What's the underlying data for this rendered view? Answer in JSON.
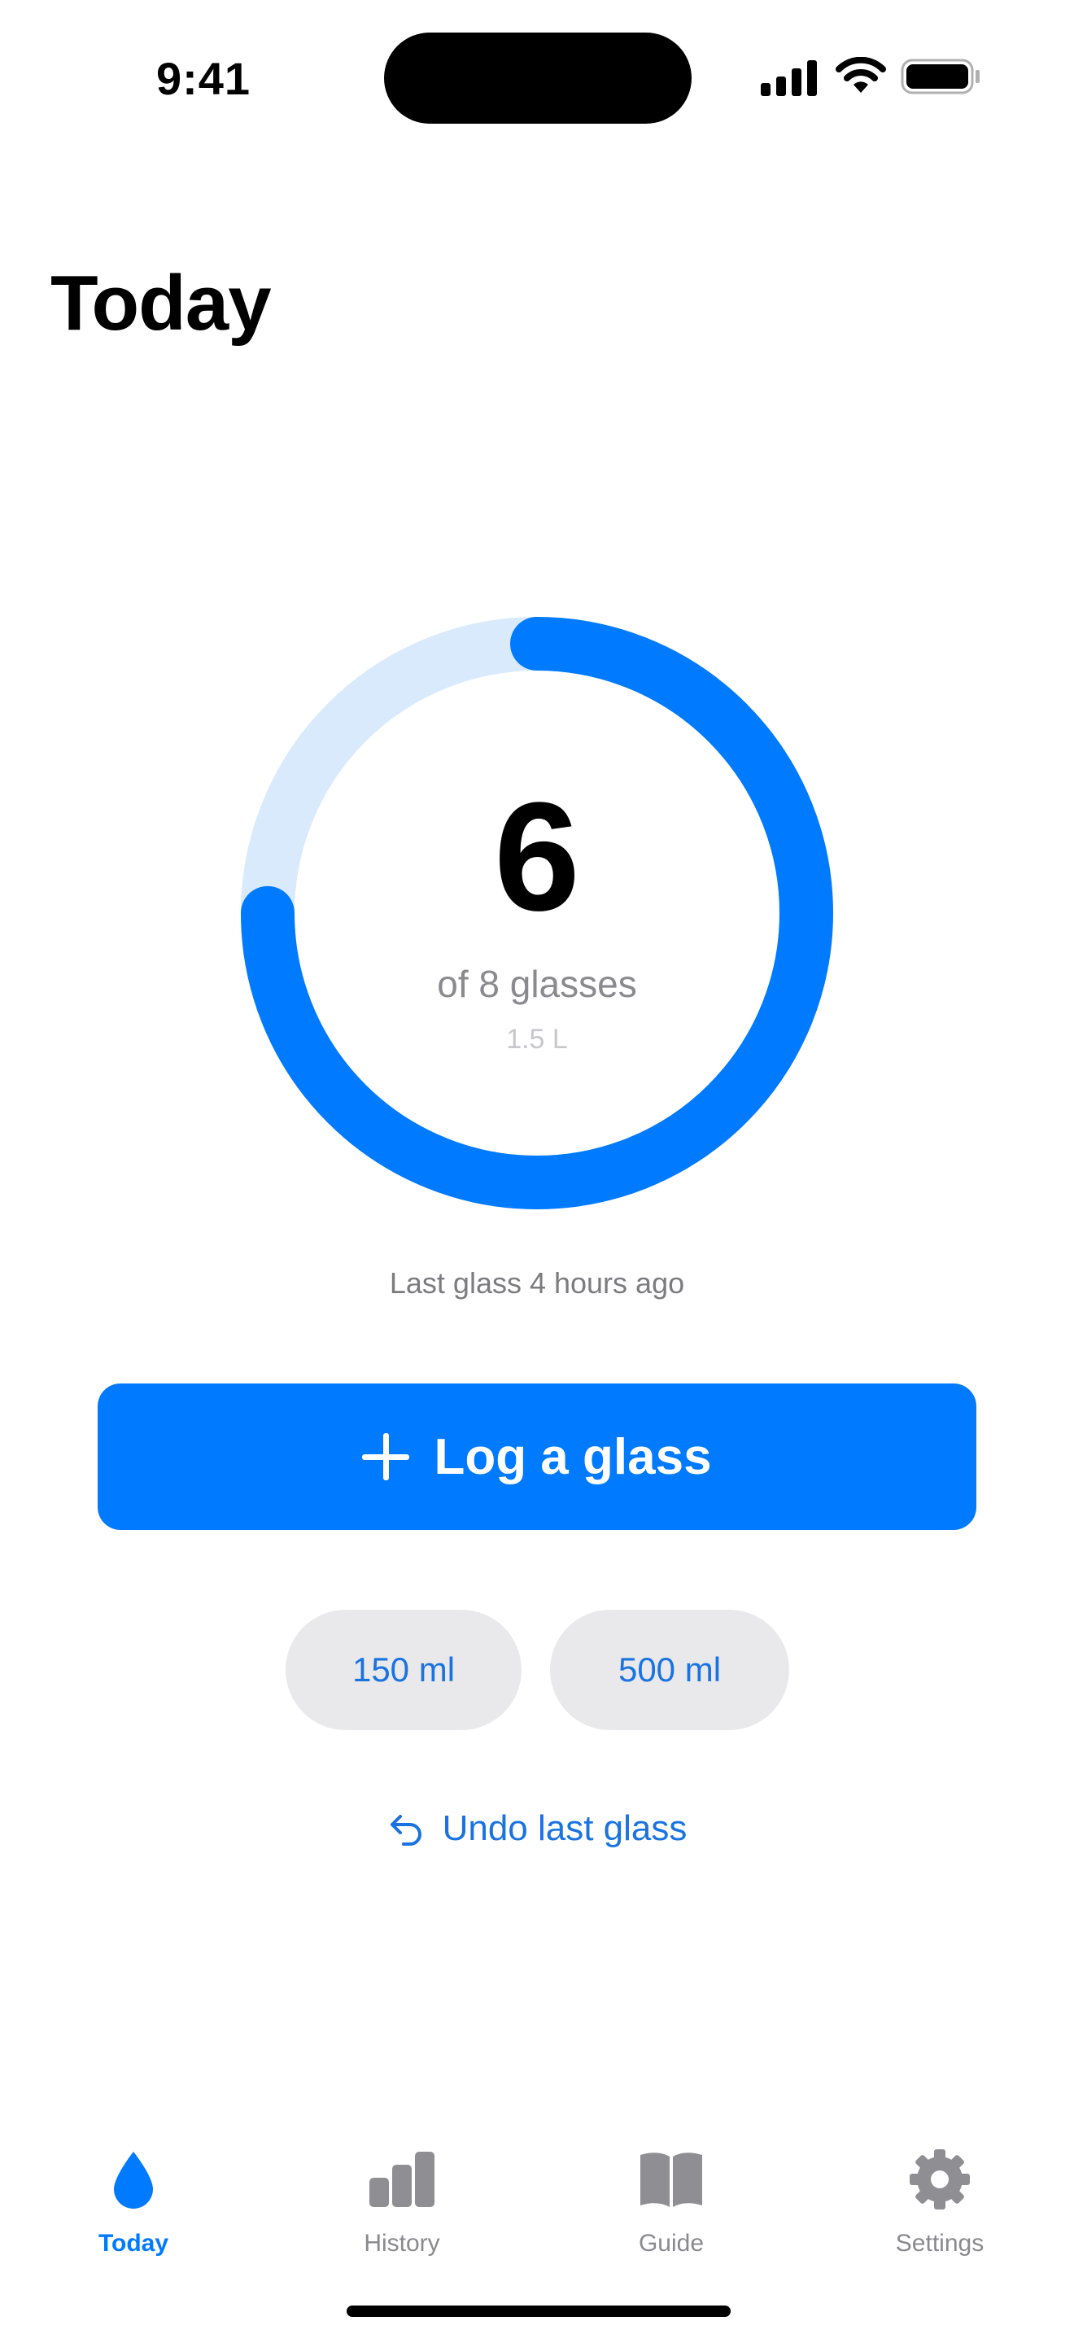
{
  "status_bar": {
    "time": "9:41"
  },
  "header": {
    "title": "Today"
  },
  "progress": {
    "count": "6",
    "goal_text": "of 8 glasses",
    "volume_text": "1.5 L",
    "glasses_logged": 6,
    "glasses_goal": 8,
    "fraction": 0.75
  },
  "last_glass_text": "Last glass 4 hours ago",
  "actions": {
    "log_label": "Log a glass",
    "quick_amounts": [
      "150 ml",
      "500 ml"
    ],
    "undo_label": "Undo last glass"
  },
  "tabs": [
    {
      "label": "Today",
      "icon": "drop-icon",
      "active": true
    },
    {
      "label": "History",
      "icon": "bar-chart-icon",
      "active": false
    },
    {
      "label": "Guide",
      "icon": "book-icon",
      "active": false
    },
    {
      "label": "Settings",
      "icon": "gear-icon",
      "active": false
    }
  ],
  "colors": {
    "accent": "#007aff",
    "ring_track": "#d9eafd",
    "chip_bg": "#e9e9eb",
    "secondary_text": "#8a8a8e",
    "inactive_tab": "#8e8e93"
  }
}
